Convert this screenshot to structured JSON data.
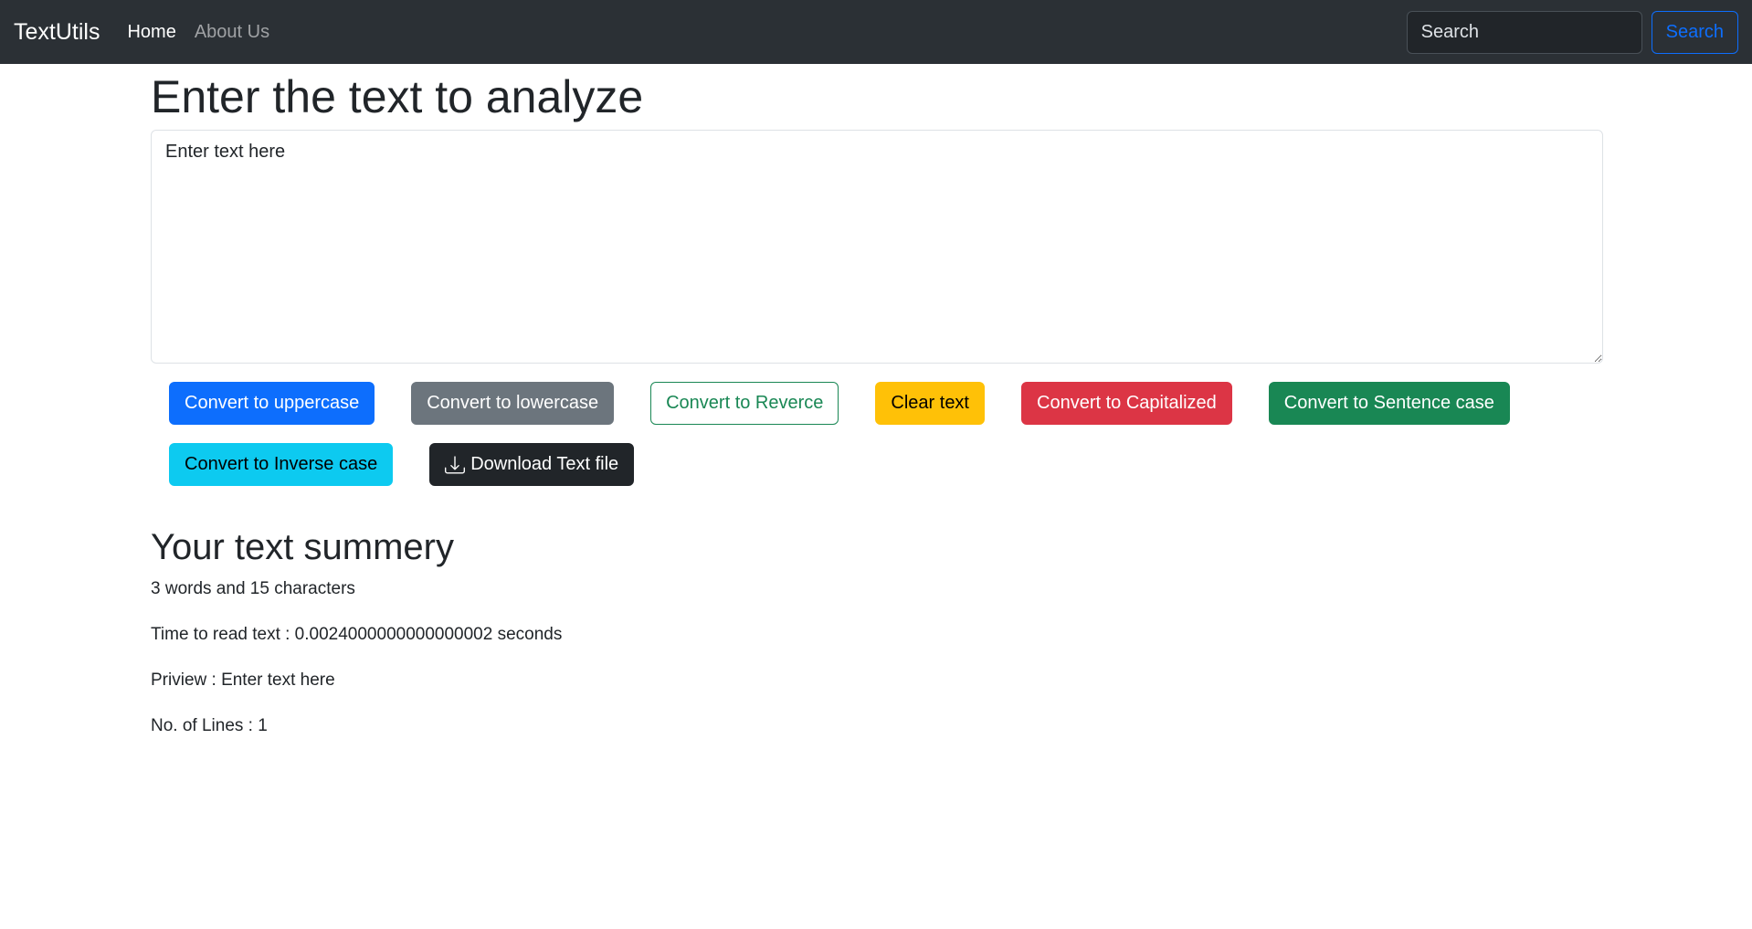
{
  "navbar": {
    "brand": "TextUtils",
    "links": [
      "Home",
      "About Us"
    ],
    "search": {
      "placeholder": "Search",
      "button_label": "Search"
    }
  },
  "main": {
    "title": "Enter the text to analyze",
    "textarea": {
      "value": "Enter text here"
    },
    "buttons": [
      "Convert to uppercase",
      "Convert to lowercase",
      "Convert to Reverce",
      "Clear text",
      "Convert to Capitalized",
      "Convert to Sentence case",
      "Convert to Inverse case",
      "Download Text file"
    ],
    "download_icon": "download-icon"
  },
  "summary": {
    "title": "Your text summery",
    "counts": "3 words and 15 characters",
    "read_time": "Time to read text : 0.0024000000000000002 seconds",
    "preview": "Priview : Enter text here",
    "lines": "No. of Lines : 1"
  },
  "colors": {
    "navbar_bg": "#2b3035",
    "primary": "#0d6efd",
    "secondary": "#6c757d",
    "success": "#198754",
    "warning": "#ffc107",
    "danger": "#dc3545",
    "info": "#0dcaf0",
    "dark": "#212529"
  }
}
